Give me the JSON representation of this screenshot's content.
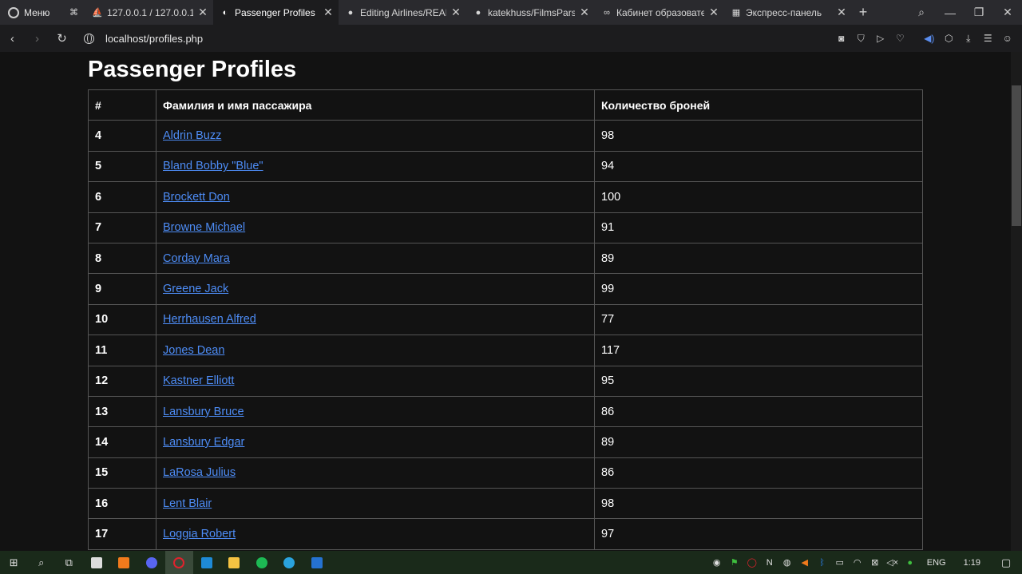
{
  "browser": {
    "menu_label": "Меню",
    "tabs": [
      {
        "title": "127.0.0.1 / 127.0.0.1 /",
        "icon": "phpmyadmin-icon",
        "glyph": "⛵",
        "active": false
      },
      {
        "title": "Passenger Profiles",
        "icon": "opera-page-icon",
        "glyph": "◐",
        "active": true
      },
      {
        "title": "Editing Airlines/READI",
        "icon": "github-icon",
        "glyph": "●",
        "active": false
      },
      {
        "title": "katekhuss/FilmsParsin",
        "icon": "github-icon",
        "glyph": "●",
        "active": false
      },
      {
        "title": "Кабинет образовател",
        "icon": "cabinet-icon",
        "glyph": "∞",
        "active": false
      },
      {
        "title": "Экспресс-панель",
        "icon": "speed-dial-icon",
        "glyph": "▦",
        "active": false
      }
    ],
    "url": "localhost/profiles.php"
  },
  "page": {
    "title": "Passenger Profiles",
    "table": {
      "headers": [
        "#",
        "Фамилия и имя пассажира",
        "Количество броней"
      ],
      "rows": [
        {
          "id": "4",
          "name": "Aldrin Buzz",
          "count": "98"
        },
        {
          "id": "5",
          "name": "Bland Bobby \"Blue\"",
          "count": "94"
        },
        {
          "id": "6",
          "name": "Brockett Don",
          "count": "100"
        },
        {
          "id": "7",
          "name": "Browne Michael",
          "count": "91"
        },
        {
          "id": "8",
          "name": "Corday Mara",
          "count": "89"
        },
        {
          "id": "9",
          "name": "Greene Jack",
          "count": "99"
        },
        {
          "id": "10",
          "name": "Herrhausen Alfred",
          "count": "77"
        },
        {
          "id": "11",
          "name": "Jones Dean",
          "count": "117"
        },
        {
          "id": "12",
          "name": "Kastner Elliott",
          "count": "95"
        },
        {
          "id": "13",
          "name": "Lansbury Bruce",
          "count": "86"
        },
        {
          "id": "14",
          "name": "Lansbury Edgar",
          "count": "89"
        },
        {
          "id": "15",
          "name": "LaRosa Julius",
          "count": "86"
        },
        {
          "id": "16",
          "name": "Lent Blair",
          "count": "98"
        },
        {
          "id": "17",
          "name": "Loggia Robert",
          "count": "97"
        }
      ]
    }
  },
  "taskbar": {
    "language": "ENG",
    "time": "1:19"
  },
  "colors": {
    "link": "#4d8cf5",
    "page_bg": "#121212",
    "taskbar_bg": "#1a2a1a"
  }
}
